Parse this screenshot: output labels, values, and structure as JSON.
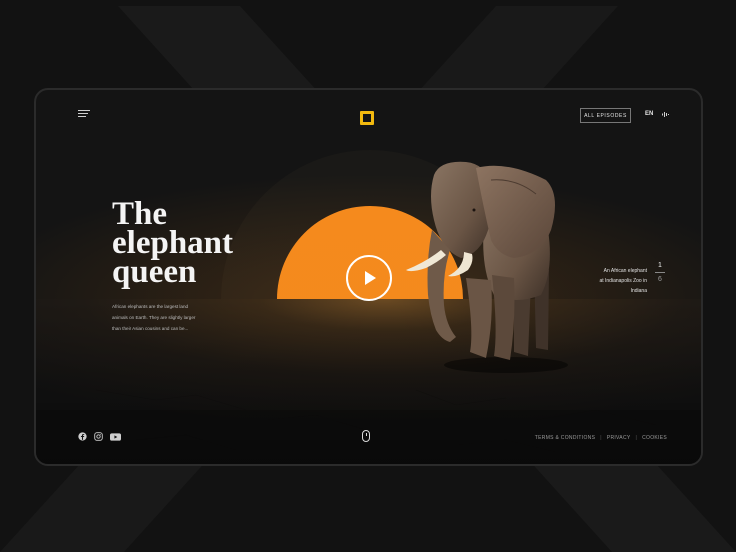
{
  "header": {
    "all_episodes_label": "ALL EPISODES",
    "language": "EN"
  },
  "hero": {
    "title_lines": [
      "The",
      "elephant",
      "queen"
    ],
    "description_lines": [
      "African elephants are the largest land",
      "animals on Earth. They are slightly larger",
      "than their Asian cousins and can be..."
    ]
  },
  "slide": {
    "caption_lines": [
      "An African elephant",
      "at Indianapolis Zoo in Indiana"
    ],
    "current": "1",
    "total": "6"
  },
  "footer": {
    "links": [
      "TERMS & CONDITIONS",
      "PRIVACY",
      "COOKIES"
    ],
    "separator": "|"
  },
  "social_icons": [
    "facebook-icon",
    "instagram-icon",
    "youtube-icon"
  ],
  "colors": {
    "accent_orange": "#f28a1b",
    "logo_yellow": "#f2b90f",
    "background": "#121212",
    "frame": "#141414"
  }
}
